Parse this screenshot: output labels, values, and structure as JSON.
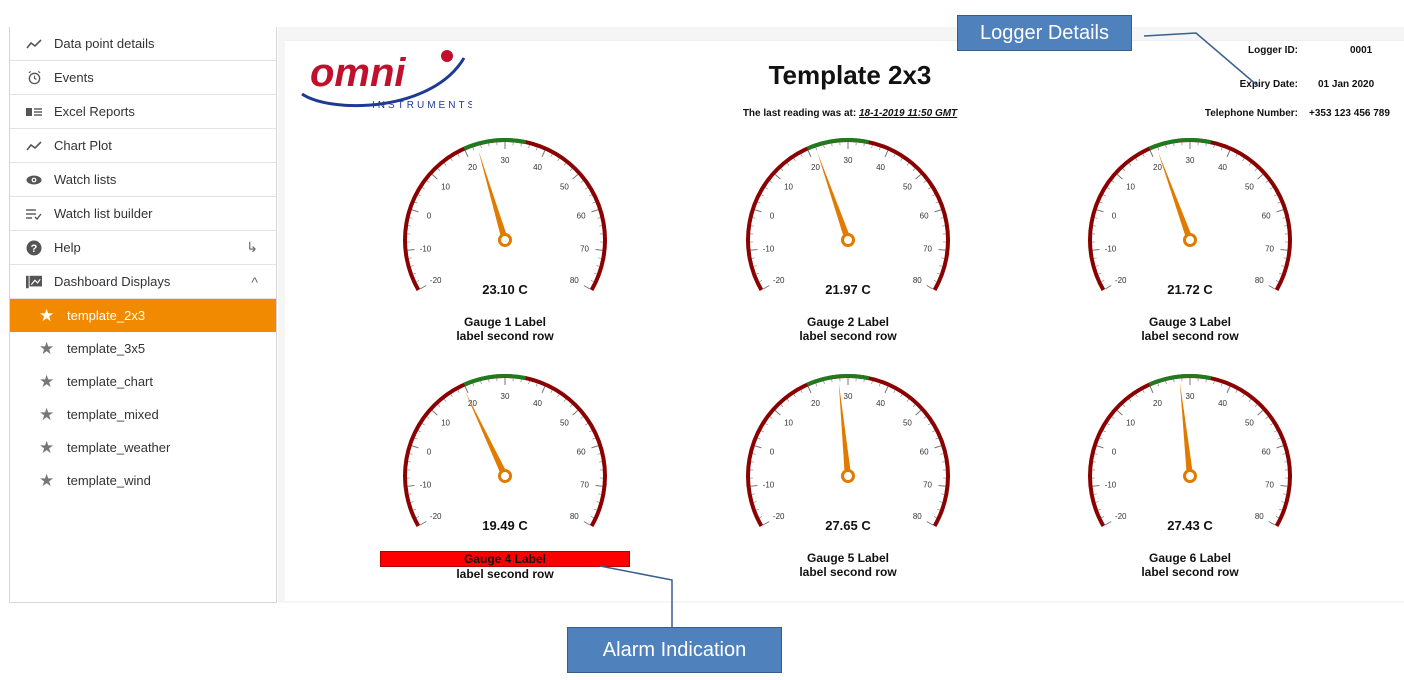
{
  "sidebar": {
    "items": [
      {
        "label": "Data point details",
        "icon": "trend-icon"
      },
      {
        "label": "Events",
        "icon": "alarm-clock-icon"
      },
      {
        "label": "Excel Reports",
        "icon": "report-list-icon"
      },
      {
        "label": "Chart Plot",
        "icon": "trend-icon"
      },
      {
        "label": "Watch lists",
        "icon": "eye-icon"
      },
      {
        "label": "Watch list builder",
        "icon": "list-check-icon"
      },
      {
        "label": "Help",
        "icon": "help-circle-icon",
        "trail": "↳"
      },
      {
        "label": "Dashboard Displays",
        "icon": "dashboard-folder-icon",
        "trail": "^"
      }
    ],
    "dashboards": [
      {
        "label": "template_2x3",
        "active": true
      },
      {
        "label": "template_3x5"
      },
      {
        "label": "template_chart"
      },
      {
        "label": "template_mixed"
      },
      {
        "label": "template_weather"
      },
      {
        "label": "template_wind"
      }
    ]
  },
  "header": {
    "brand": "omni",
    "brand_sub": "INSTRUMENTS",
    "title": "Template 2x3",
    "last_reading_prefix": "The last reading was at:",
    "last_reading_time": "18-1-2019 11:50 GMT"
  },
  "logger": {
    "id_label": "Logger ID:",
    "id_value": "0001",
    "expiry_label": "Expiry Date:",
    "expiry_value": "01 Jan 2020",
    "phone_label": "Telephone Number:",
    "phone_value": "+353 123 456 789"
  },
  "gauges": [
    {
      "value": 23.1,
      "display": "23.10 C",
      "label": "Gauge 1 Label",
      "label2": "label second row",
      "alarm": false
    },
    {
      "value": 21.97,
      "display": "21.97 C",
      "label": "Gauge 2 Label",
      "label2": "label second row",
      "alarm": false
    },
    {
      "value": 21.72,
      "display": "21.72 C",
      "label": "Gauge 3 Label",
      "label2": "label second row",
      "alarm": false
    },
    {
      "value": 19.49,
      "display": "19.49 C",
      "label": "Gauge 4 Label",
      "label2": "label second row",
      "alarm": true
    },
    {
      "value": 27.65,
      "display": "27.65 C",
      "label": "Gauge 5 Label",
      "label2": "label second row",
      "alarm": false
    },
    {
      "value": 27.43,
      "display": "27.43 C",
      "label": "Gauge 6 Label",
      "label2": "label second row",
      "alarm": false
    }
  ],
  "gauge_scale": {
    "min": -20,
    "max": 80,
    "ticks": [
      "-20",
      "-10",
      "0",
      "10",
      "20",
      "30",
      "40",
      "50",
      "60",
      "70",
      "80"
    ],
    "green_band": [
      20,
      35
    ]
  },
  "callouts": {
    "logger_details": "Logger Details",
    "alarm_indication": "Alarm Indication"
  },
  "colors": {
    "accent": "#f28a00",
    "gauge_arc": "#8b0000",
    "gauge_green": "#1e7b1e",
    "needle": "#e07b00",
    "alarm": "#ff0000",
    "callout": "#4f81bd",
    "brand_red": "#c0102e",
    "brand_blue": "#1f3a93"
  }
}
